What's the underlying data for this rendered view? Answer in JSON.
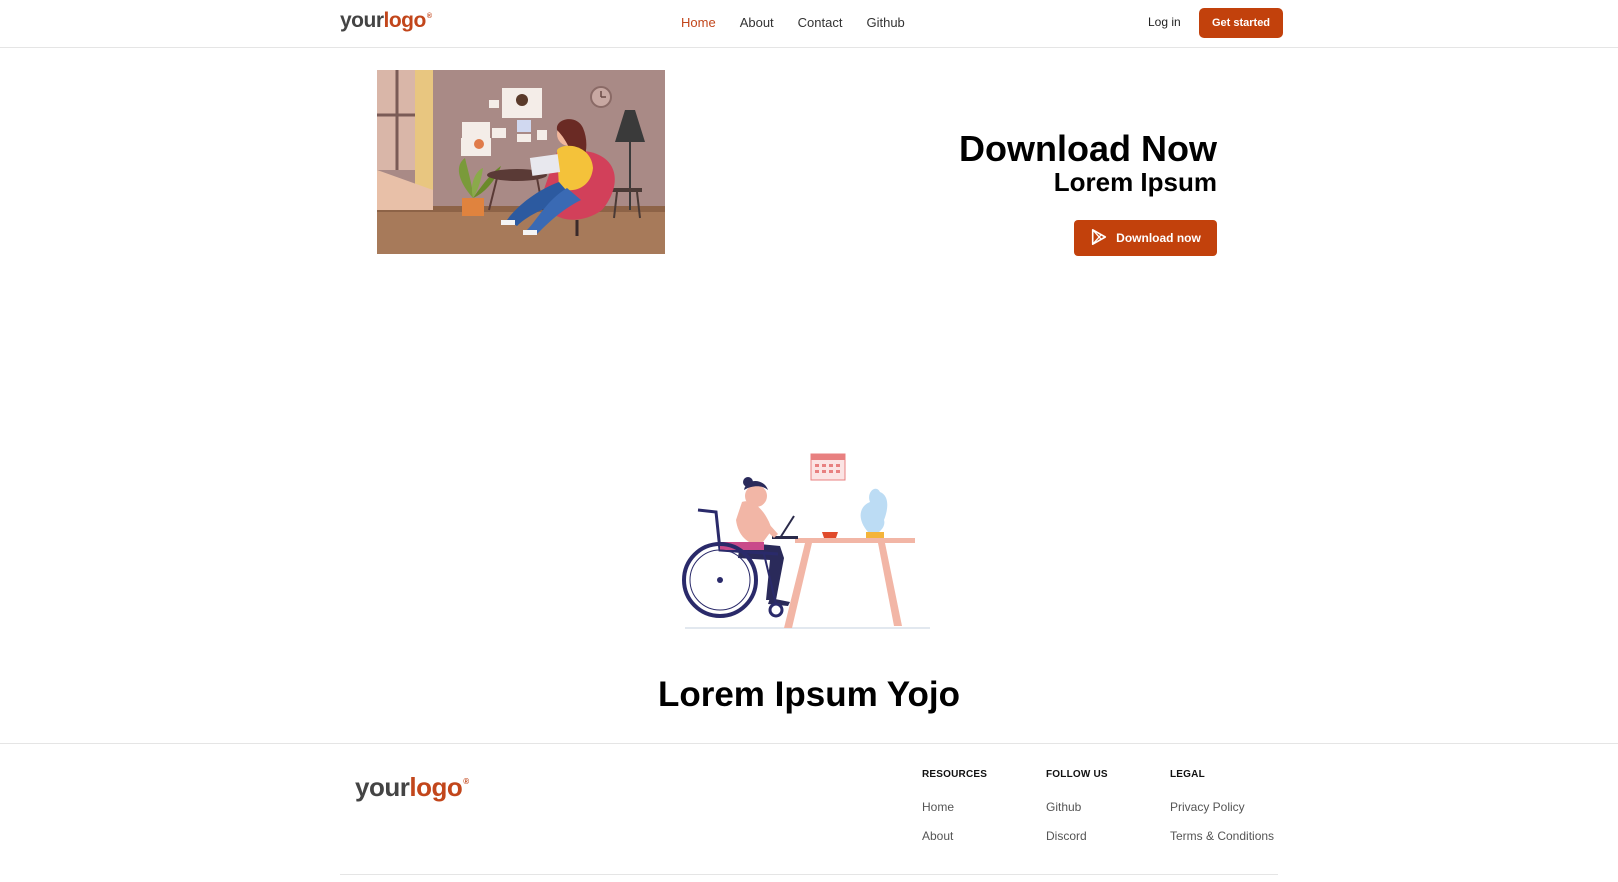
{
  "header": {
    "logo": {
      "part1": "your",
      "part2": "logo",
      "mark": "®"
    },
    "nav": [
      {
        "label": "Home",
        "active": true
      },
      {
        "label": "About",
        "active": false
      },
      {
        "label": "Contact",
        "active": false
      },
      {
        "label": "Github",
        "active": false
      }
    ],
    "login_label": "Log in",
    "cta_label": "Get started"
  },
  "hero": {
    "title": "Download Now",
    "subtitle": "Lorem Ipsum",
    "button_label": "Download now",
    "button_icon": "play-store-icon"
  },
  "section": {
    "title": "Lorem Ipsum Yojo"
  },
  "footer": {
    "logo": {
      "part1": "your",
      "part2": "logo",
      "mark": "®"
    },
    "columns": [
      {
        "heading": "RESOURCES",
        "links": [
          "Home",
          "About"
        ]
      },
      {
        "heading": "FOLLOW US",
        "links": [
          "Github",
          "Discord"
        ]
      },
      {
        "heading": "LEGAL",
        "links": [
          "Privacy Policy",
          "Terms & Conditions"
        ]
      }
    ]
  },
  "colors": {
    "accent": "#c2410c",
    "text": "#111111",
    "muted": "#555555",
    "border": "#e5e5e5"
  }
}
